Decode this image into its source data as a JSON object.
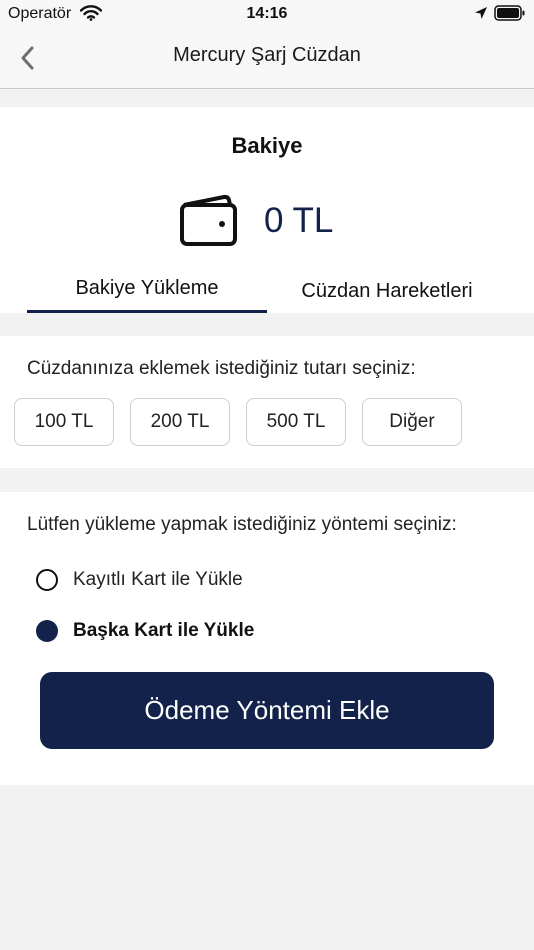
{
  "status_bar": {
    "carrier": "Operatör",
    "time": "14:16",
    "icons": [
      "wifi-icon",
      "location-arrow-icon",
      "battery-icon"
    ]
  },
  "nav": {
    "title": "Mercury Şarj Cüzdan",
    "back_icon": "chevron-left-icon"
  },
  "balance": {
    "label": "Bakiye",
    "value": "0 TL",
    "icon": "wallet-icon"
  },
  "tabs": [
    {
      "label": "Bakiye Yükleme",
      "active": true
    },
    {
      "label": "Cüzdan Hareketleri",
      "active": false
    }
  ],
  "amount": {
    "prompt": "Cüzdanınıza eklemek istediğiniz tutarı seçiniz:",
    "options": [
      "100 TL",
      "200 TL",
      "500 TL",
      "Diğer"
    ]
  },
  "method": {
    "prompt": "Lütfen yükleme yapmak istediğiniz yöntemi seçiniz:",
    "options": [
      {
        "label": "Kayıtlı Kart ile Yükle",
        "selected": false
      },
      {
        "label": "Başka Kart ile Yükle",
        "selected": true
      }
    ],
    "button_label": "Ödeme Yöntemi Ekle"
  },
  "colors": {
    "accent": "#12224a",
    "background": "#f2f2f3",
    "card": "#ffffff",
    "chip_border": "#cfcfd3"
  }
}
